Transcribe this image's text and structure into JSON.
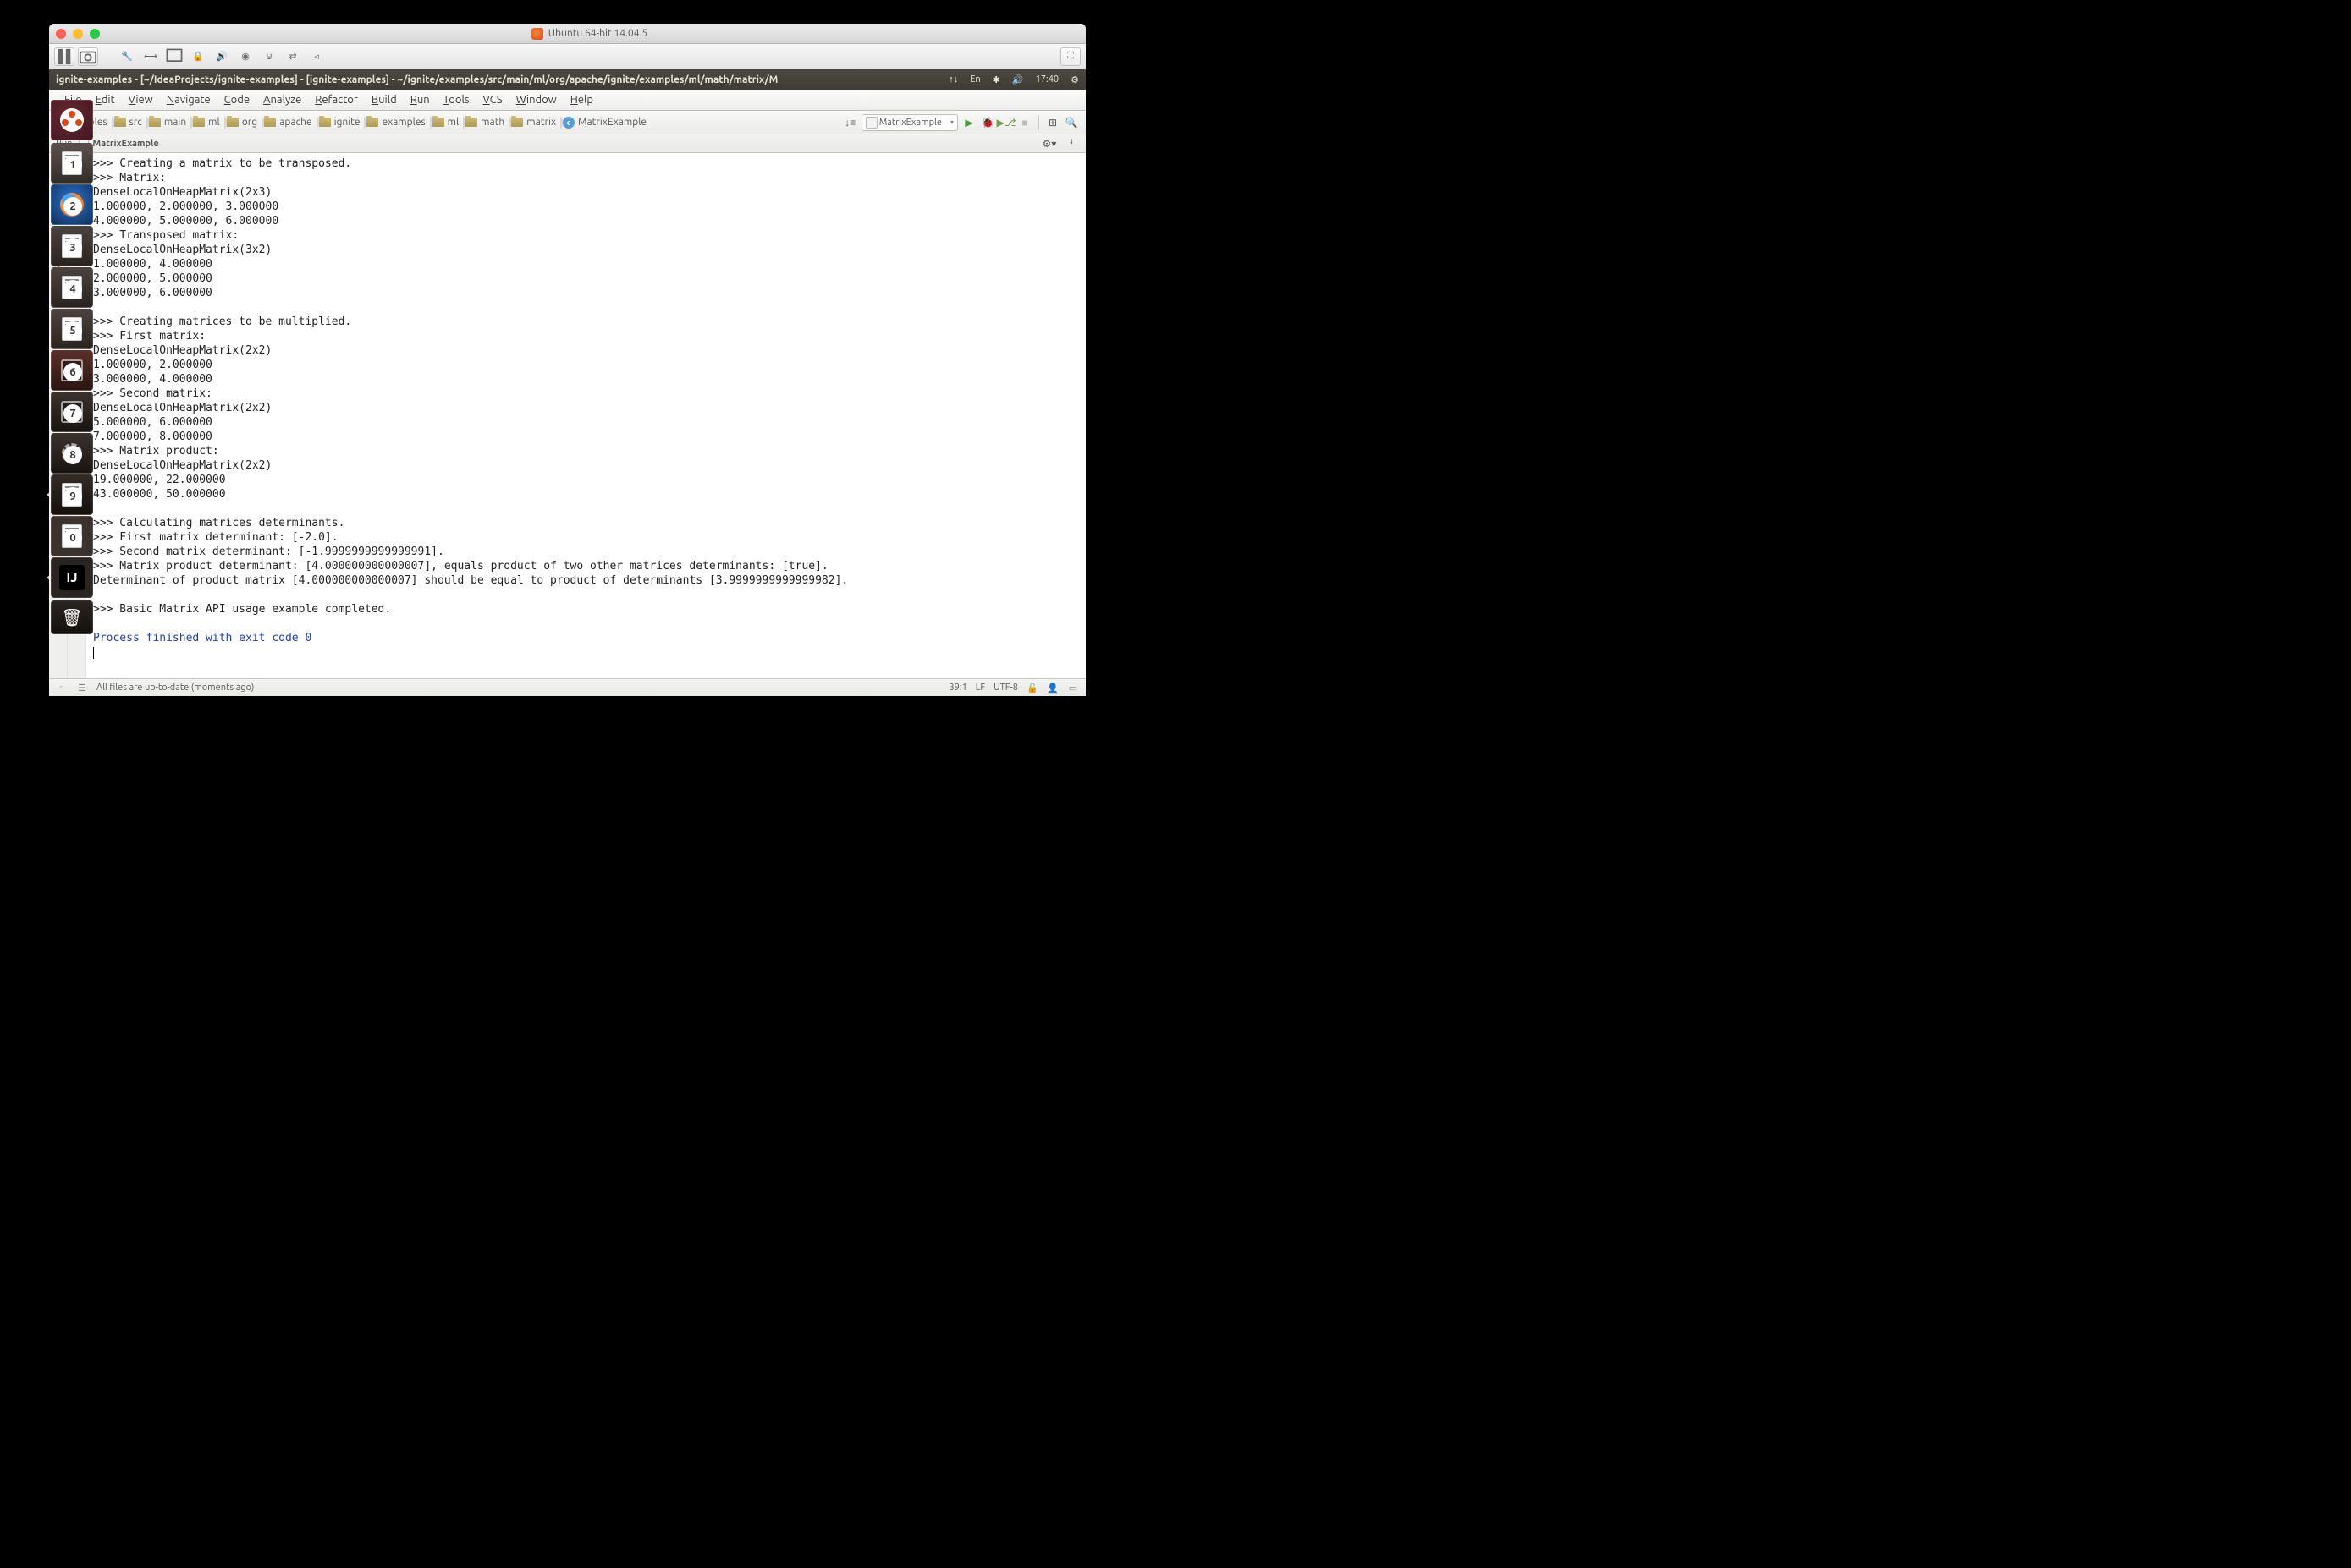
{
  "mac_title": "Ubuntu 64-bit 14.04.5",
  "ubuntu_title": "ignite-examples - [~/IdeaProjects/ignite-examples] - [ignite-examples] - ~/ignite/examples/src/main/ml/org/apache/ignite/examples/ml/math/matrix/M",
  "indicators": {
    "lang": "En",
    "time": "17:40"
  },
  "menu": [
    "File",
    "Edit",
    "View",
    "Navigate",
    "Code",
    "Analyze",
    "Refactor",
    "Build",
    "Run",
    "Tools",
    "VCS",
    "Window",
    "Help"
  ],
  "breadcrumbs": [
    {
      "label": "xamples",
      "icon": "folder"
    },
    {
      "label": "src",
      "icon": "folder"
    },
    {
      "label": "main",
      "icon": "folder"
    },
    {
      "label": "ml",
      "icon": "folder"
    },
    {
      "label": "org",
      "icon": "folder"
    },
    {
      "label": "apache",
      "icon": "folder"
    },
    {
      "label": "ignite",
      "icon": "folder"
    },
    {
      "label": "examples",
      "icon": "folder"
    },
    {
      "label": "ml",
      "icon": "folder"
    },
    {
      "label": "math",
      "icon": "folder"
    },
    {
      "label": "matrix",
      "icon": "folder"
    },
    {
      "label": "MatrixExample",
      "icon": "class"
    }
  ],
  "run_config": "MatrixExample",
  "run_header": {
    "label": "Run",
    "name": "MatrixExample"
  },
  "console_lines": [
    ">>> Creating a matrix to be transposed.",
    ">>> Matrix:",
    "DenseLocalOnHeapMatrix(2x3)",
    "1.000000, 2.000000, 3.000000",
    "4.000000, 5.000000, 6.000000",
    ">>> Transposed matrix:",
    "DenseLocalOnHeapMatrix(3x2)",
    "1.000000, 4.000000",
    "2.000000, 5.000000",
    "3.000000, 6.000000",
    "",
    ">>> Creating matrices to be multiplied.",
    ">>> First matrix:",
    "DenseLocalOnHeapMatrix(2x2)",
    "1.000000, 2.000000",
    "3.000000, 4.000000",
    ">>> Second matrix:",
    "DenseLocalOnHeapMatrix(2x2)",
    "5.000000, 6.000000",
    "7.000000, 8.000000",
    ">>> Matrix product:",
    "DenseLocalOnHeapMatrix(2x2)",
    "19.000000, 22.000000",
    "43.000000, 50.000000",
    "",
    ">>> Calculating matrices determinants.",
    ">>> First matrix determinant: [-2.0].",
    ">>> Second matrix determinant: [-1.9999999999999991].",
    ">>> Matrix product determinant: [4.000000000000007], equals product of two other matrices determinants: [true].",
    "Determinant of product matrix [4.000000000000007] should be equal to product of determinants [3.9999999999999982].",
    "",
    ">>> Basic Matrix API usage example completed.",
    ""
  ],
  "console_exit": "Process finished with exit code 0",
  "status": {
    "msg": "All files are up-to-date (moments ago)",
    "pos": "39:1",
    "sep": "LF",
    "enc": "UTF-8"
  },
  "launcher": {
    "items": [
      {
        "name": "files",
        "badge": "1"
      },
      {
        "name": "firefox",
        "badge": "2"
      },
      {
        "name": "writer",
        "badge": "3"
      },
      {
        "name": "calc",
        "badge": "4"
      },
      {
        "name": "impress",
        "badge": "5"
      },
      {
        "name": "software",
        "badge": "6"
      },
      {
        "name": "amazon",
        "badge": "7"
      },
      {
        "name": "settings",
        "badge": "8"
      },
      {
        "name": "terminal",
        "badge": "9",
        "arrow": true
      },
      {
        "name": "libreoffice",
        "badge": "0"
      },
      {
        "name": "intellij",
        "label": "IJ",
        "arrow": true
      }
    ]
  }
}
